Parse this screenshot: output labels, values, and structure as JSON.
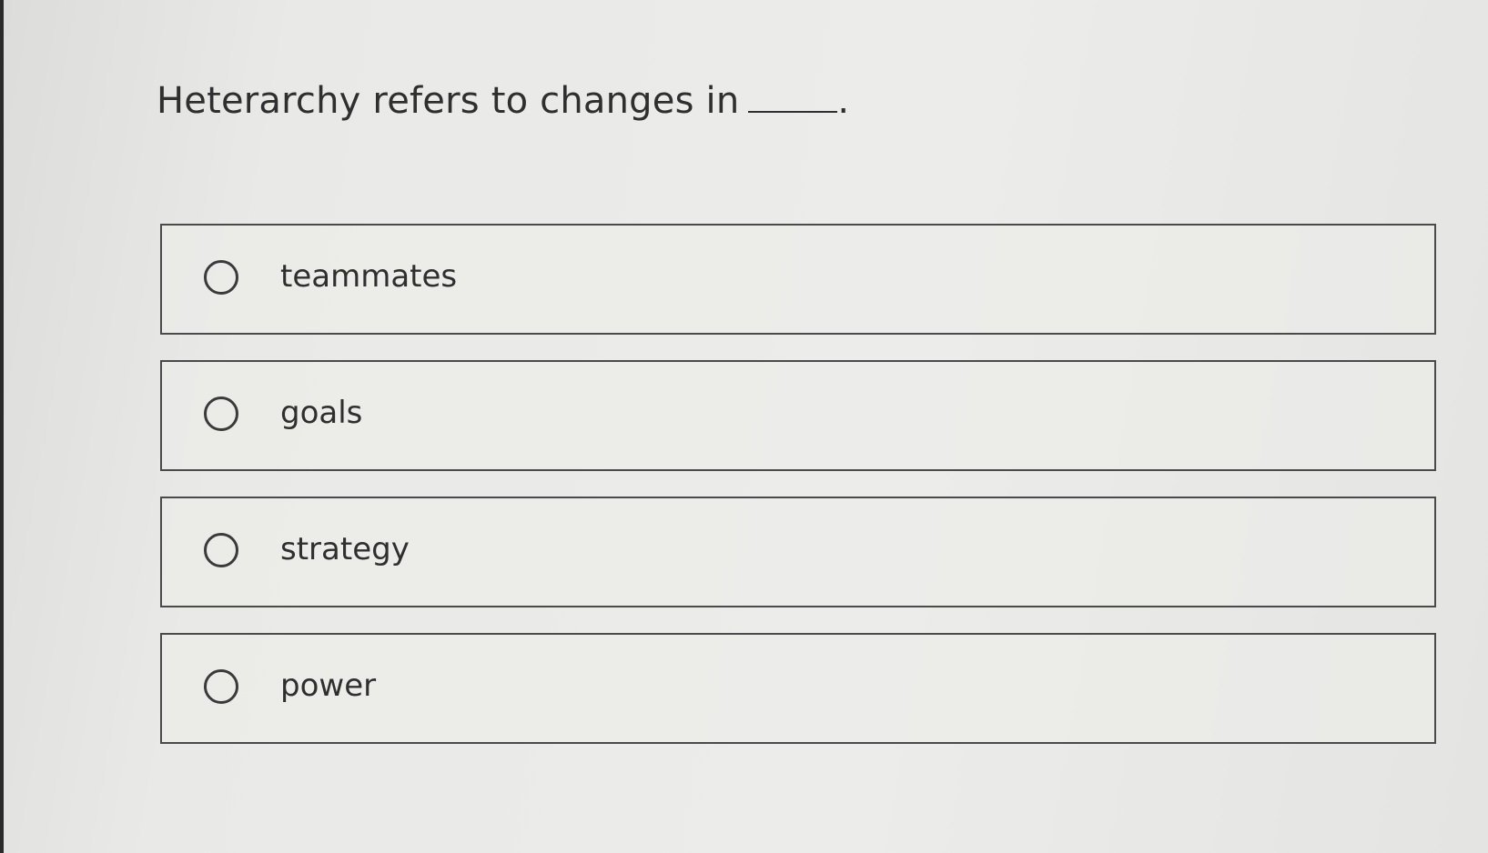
{
  "question": {
    "text": "Heterarchy refers to changes in",
    "trailing": "."
  },
  "options": [
    {
      "label": "teammates"
    },
    {
      "label": "goals"
    },
    {
      "label": "strategy"
    },
    {
      "label": "power"
    }
  ]
}
